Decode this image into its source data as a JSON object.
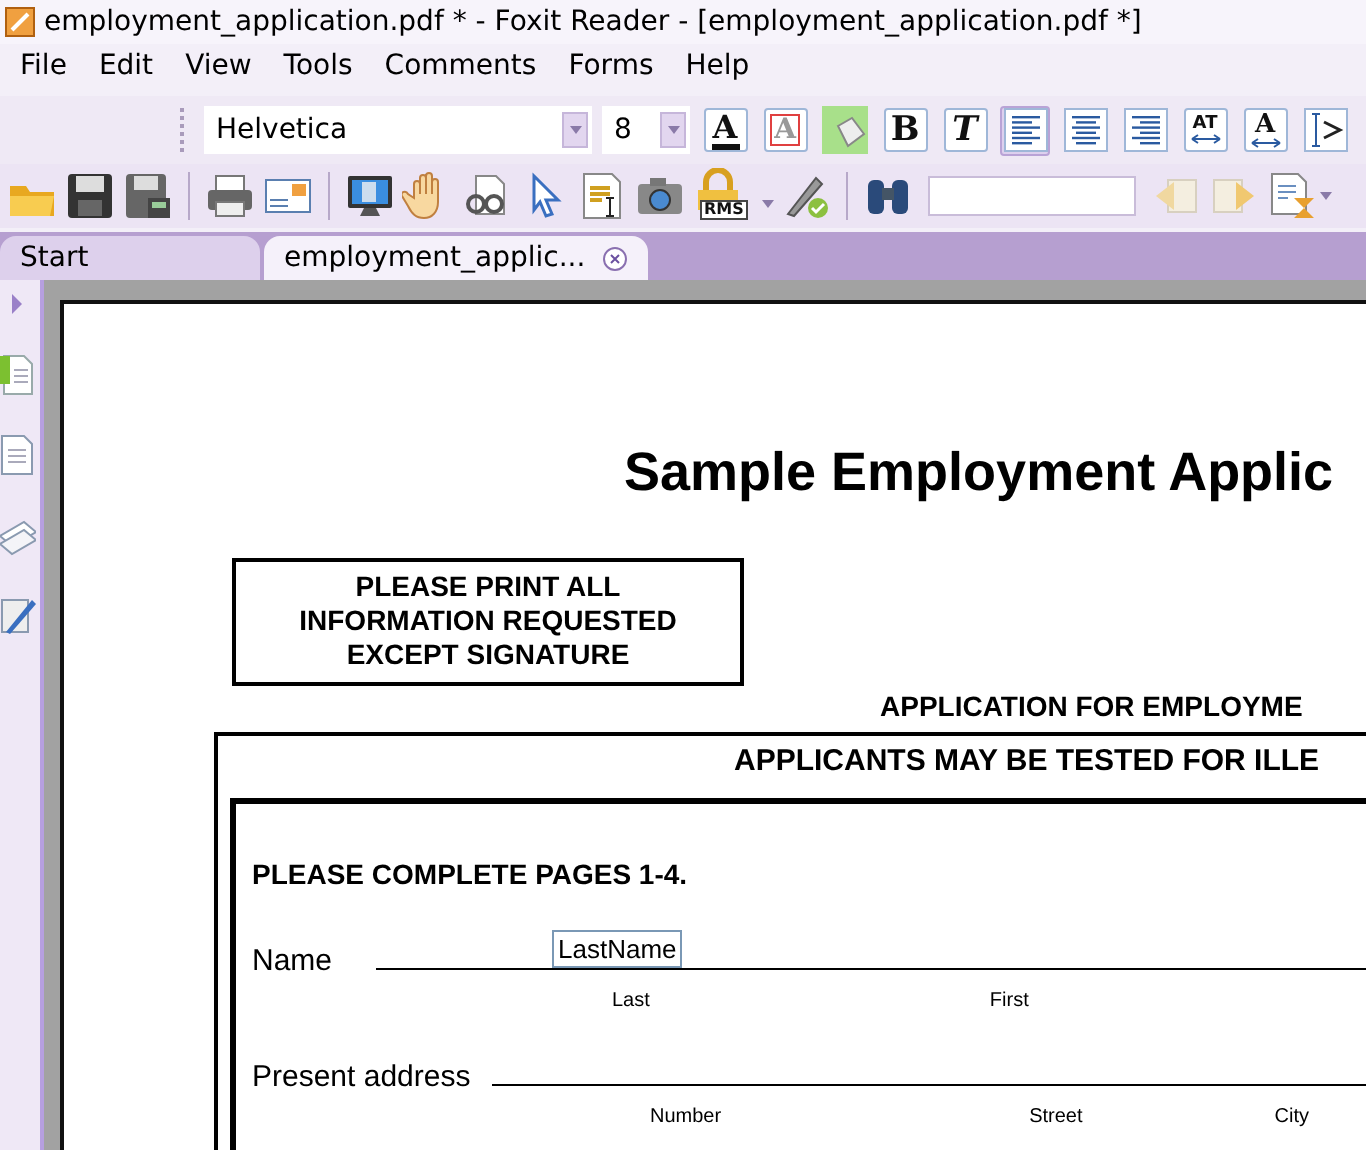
{
  "window": {
    "title": "employment_application.pdf * - Foxit Reader - [employment_application.pdf *]"
  },
  "menu": [
    "File",
    "Edit",
    "View",
    "Tools",
    "Comments",
    "Forms",
    "Help"
  ],
  "format_toolbar": {
    "font": "Helvetica",
    "size": "8",
    "buttons": [
      {
        "kind": "text-color",
        "glyph": "A",
        "selected": false
      },
      {
        "kind": "border-color",
        "glyph": "A",
        "selected": false
      },
      {
        "kind": "fill-color",
        "selected": false
      },
      {
        "kind": "bold",
        "glyph": "B",
        "selected": false
      },
      {
        "kind": "italic",
        "glyph": "T",
        "selected": false
      },
      {
        "kind": "align-left",
        "selected": true
      },
      {
        "kind": "align-center",
        "selected": false
      },
      {
        "kind": "align-right",
        "selected": false
      },
      {
        "kind": "char-spacing",
        "glyph": "AT",
        "selected": false
      },
      {
        "kind": "horizontal-scale",
        "glyph": "A",
        "selected": false
      },
      {
        "kind": "text-direction",
        "selected": false
      }
    ]
  },
  "main_toolbar": {
    "items": [
      {
        "kind": "open"
      },
      {
        "kind": "save"
      },
      {
        "kind": "save-as"
      },
      {
        "kind": "separator"
      },
      {
        "kind": "print"
      },
      {
        "kind": "email"
      },
      {
        "kind": "separator"
      },
      {
        "kind": "fullscreen"
      },
      {
        "kind": "hand"
      },
      {
        "kind": "loupe"
      },
      {
        "kind": "select"
      },
      {
        "kind": "text-select"
      },
      {
        "kind": "snapshot"
      },
      {
        "kind": "rms",
        "glyph": "RMS",
        "has_menu": true
      },
      {
        "kind": "sign"
      },
      {
        "kind": "separator"
      },
      {
        "kind": "find"
      },
      {
        "kind": "find-field"
      },
      {
        "kind": "previous"
      },
      {
        "kind": "next"
      },
      {
        "kind": "hourglass",
        "has_menu": true
      }
    ]
  },
  "tabs": [
    {
      "label": "Start",
      "selected": false,
      "closable": false
    },
    {
      "label": "employment_applic...",
      "selected": true,
      "closable": true
    }
  ],
  "sidebar": {
    "items": [
      {
        "kind": "bookmarks"
      },
      {
        "kind": "pages"
      },
      {
        "kind": "layers"
      },
      {
        "kind": "signatures"
      }
    ]
  },
  "document": {
    "title": "Sample Employment Applic",
    "notice": [
      "PLEASE PRINT ALL",
      "INFORMATION REQUESTED",
      "EXCEPT SIGNATURE"
    ],
    "heading": "APPLICATION FOR EMPLOYME",
    "banner": "APPLICANTS MAY BE TESTED FOR ILLE",
    "instruction": "PLEASE COMPLETE PAGES 1-4.",
    "rows": [
      {
        "label": "Name",
        "field_value": "LastName",
        "sublabels": [
          "Last",
          "First"
        ]
      },
      {
        "label": "Present address",
        "sublabels": [
          "Number",
          "Street",
          "City"
        ]
      }
    ]
  }
}
